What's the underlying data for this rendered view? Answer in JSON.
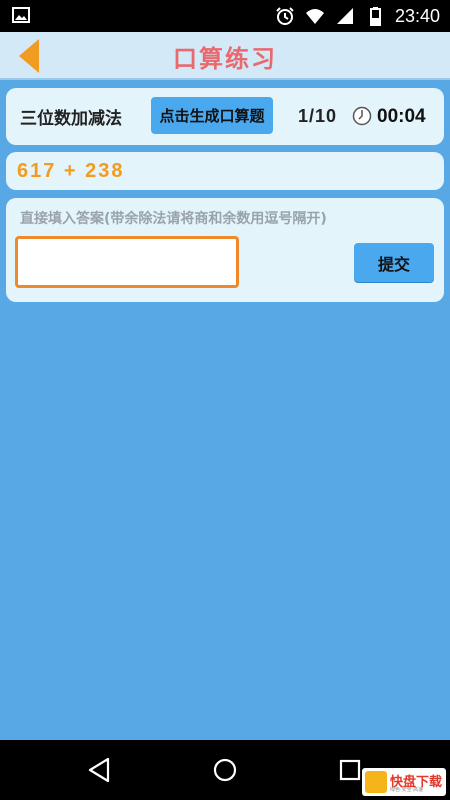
{
  "status_bar": {
    "time": "23:40",
    "icons": [
      "image-icon",
      "alarm-icon",
      "wifi-icon",
      "signal-icon",
      "battery-icon"
    ]
  },
  "header": {
    "title": "口算练习",
    "back_icon": "chevron-left-icon",
    "accent_color": "#f29b21",
    "title_color": "#e8696e"
  },
  "practice": {
    "mode_label": "三位数加减法",
    "generate_button": "点击生成口算题",
    "progress": "1/10",
    "timer_icon": "stopwatch-icon",
    "timer": "00:04",
    "problem": "617 + 238",
    "hint": "直接填入答案(带余除法请将商和余数用逗号隔开)",
    "answer_value": "",
    "submit_button": "提交"
  },
  "nav_bar": {
    "icons": [
      "back-triangle-icon",
      "home-circle-icon",
      "recents-square-icon"
    ]
  },
  "watermark": {
    "text": "快盘下载",
    "logo_char": "快",
    "sub": "绿色·安全·高速"
  }
}
